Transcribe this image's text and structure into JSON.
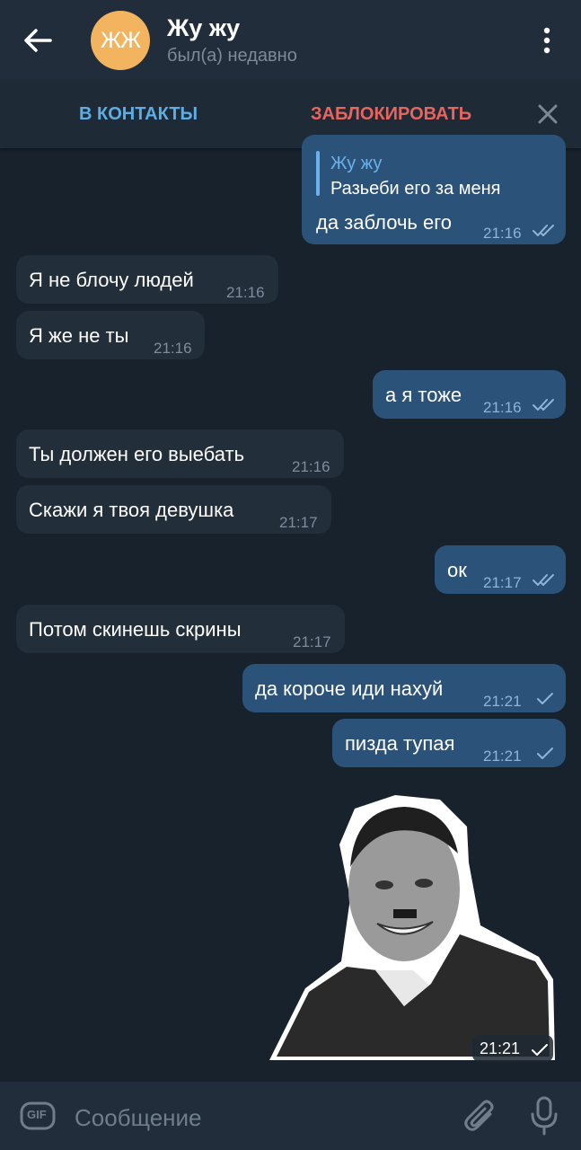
{
  "header": {
    "avatar_initials": "ЖЖ",
    "title": "Жу жу",
    "status": "был(а) недавно",
    "avatar_color": "#f2b45e"
  },
  "actions": {
    "add_contact": "В КОНТАКТЫ",
    "block": "ЗАБЛОКИРОВАТЬ"
  },
  "messages": [
    {
      "dir": "out",
      "reply_name": "Жу жу",
      "reply_text": "Разьеби его за меня",
      "text": "да заблочь его",
      "time": "21:16",
      "read": true
    },
    {
      "dir": "in",
      "text": "Я не блочу людей",
      "time": "21:16"
    },
    {
      "dir": "in",
      "text": "Я же не ты",
      "time": "21:16"
    },
    {
      "dir": "out",
      "text": "а я тоже",
      "time": "21:16",
      "read": true
    },
    {
      "dir": "in",
      "text": "Ты должен его выебать",
      "time": "21:16"
    },
    {
      "dir": "in",
      "text": "Скажи я твоя девушка",
      "time": "21:17"
    },
    {
      "dir": "out",
      "text": "ок",
      "time": "21:17",
      "read": true
    },
    {
      "dir": "in",
      "text": "Потом скинешь скрины",
      "time": "21:17"
    },
    {
      "dir": "out",
      "text": "да короче иди нахуй",
      "time": "21:21",
      "read": false
    },
    {
      "dir": "out",
      "text": "пизда тупая",
      "time": "21:21",
      "read": false
    }
  ],
  "sticker": {
    "time": "21:21",
    "description_icon": "sticker-portrait"
  },
  "input": {
    "placeholder": "Сообщение",
    "gif_label": "GIF"
  },
  "colors": {
    "in_bubble": "#222e3a",
    "out_bubble": "#2b5278",
    "accent": "#6ab2ee",
    "block": "#e8655e",
    "background": "#18222d"
  }
}
